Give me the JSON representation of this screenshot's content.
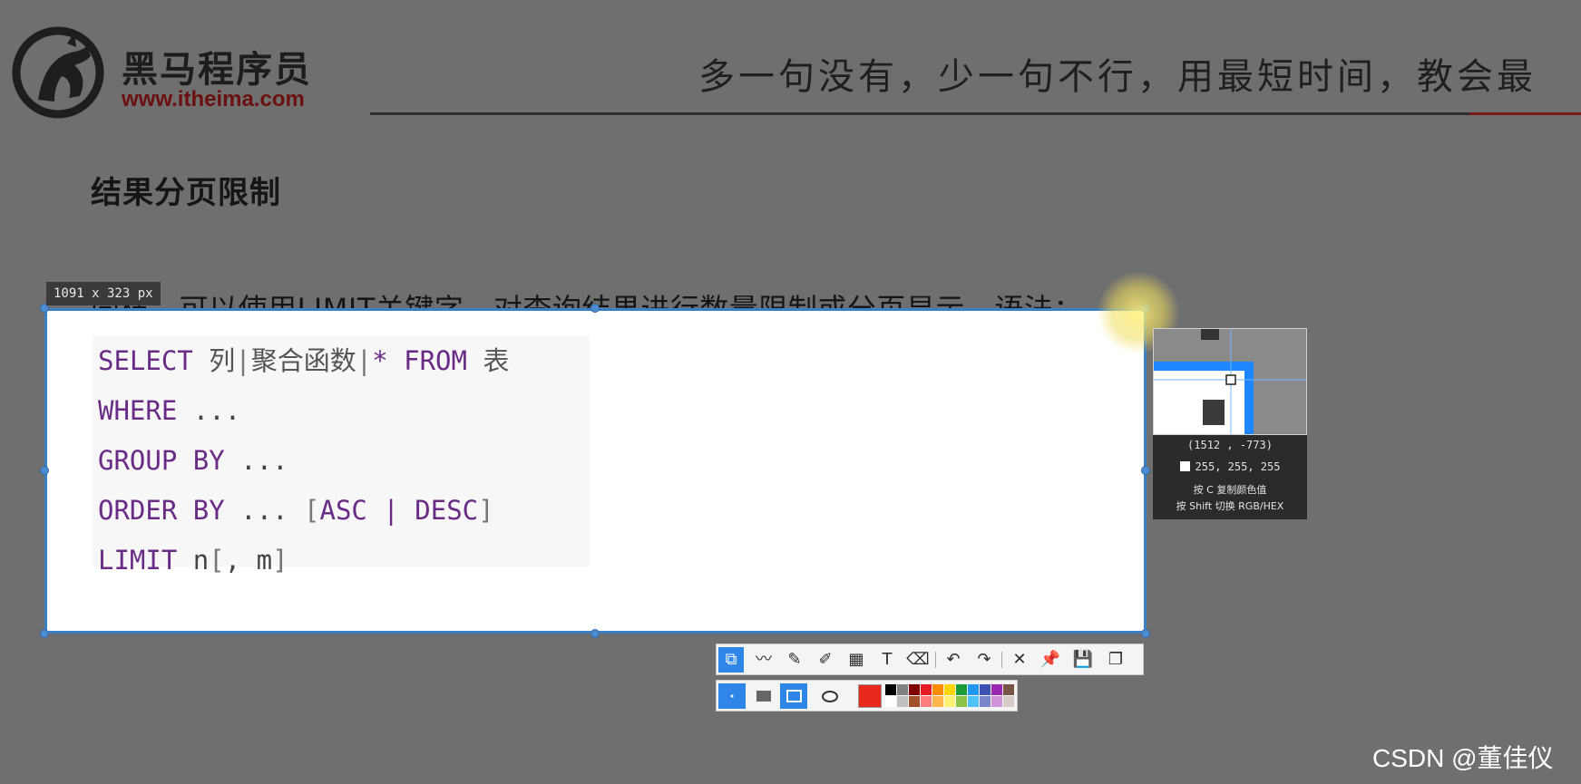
{
  "slide": {
    "logo": {
      "name": "黑马程序员",
      "url": "www.itheima.com"
    },
    "slogan": "多一句没有，少一句不行，用最短时间，教会最",
    "section_title": "结果分页限制",
    "intro": "同样，可以使用LIMIT关键字，对查询结果进行数量限制或分页显示，语法："
  },
  "code": {
    "line1": {
      "kw1": "SELECT",
      "cn1": "列",
      "sep1": "|",
      "cn2": "聚合函数",
      "sep2": "|",
      "star": "*",
      "kw2": "FROM",
      "cn3": "表"
    },
    "line2": {
      "kw": "WHERE",
      "rest": "..."
    },
    "line3": {
      "kw": "GROUP BY",
      "rest": "..."
    },
    "line4": {
      "kw1": "ORDER BY",
      "dots": "...",
      "open": "[",
      "asc": "ASC",
      "bar": "|",
      "desc": "DESC",
      "close": "]"
    },
    "line5": {
      "kw": "LIMIT",
      "n": "n",
      "open": "[",
      "comma": ",",
      "m": "m",
      "close": "]"
    }
  },
  "capture": {
    "size_label": "1091 x 323  px",
    "magnifier": {
      "coords": "(1512 , -773)",
      "color_value": "255, 255, 255",
      "hint_copy": "按 C 复制颜色值",
      "hint_switch": "按 Shift 切换 RGB/HEX"
    },
    "toolbar_icons": [
      "crop-mode-icon",
      "polyline-icon",
      "pencil-icon",
      "marker-icon",
      "mosaic-icon",
      "text-icon",
      "eraser-icon",
      "undo-icon",
      "redo-icon",
      "close-icon",
      "pin-icon",
      "save-icon",
      "copy-icon"
    ],
    "selected_color": "#e82a1e",
    "palette": [
      "#000000",
      "#808080",
      "#800000",
      "#e51c23",
      "#ff8c00",
      "#ffd600",
      "#1a9c3a",
      "#2196f3",
      "#3f51b5",
      "#9c27b0",
      "#795548",
      "#ffffff",
      "#c0c0c0",
      "#a0522d",
      "#ff7f7f",
      "#ffb74d",
      "#fff176",
      "#8bc34a",
      "#4fc3f7",
      "#7986cb",
      "#ce93d8",
      "#d7ccc8"
    ]
  },
  "watermark": "CSDN @董佳仪"
}
